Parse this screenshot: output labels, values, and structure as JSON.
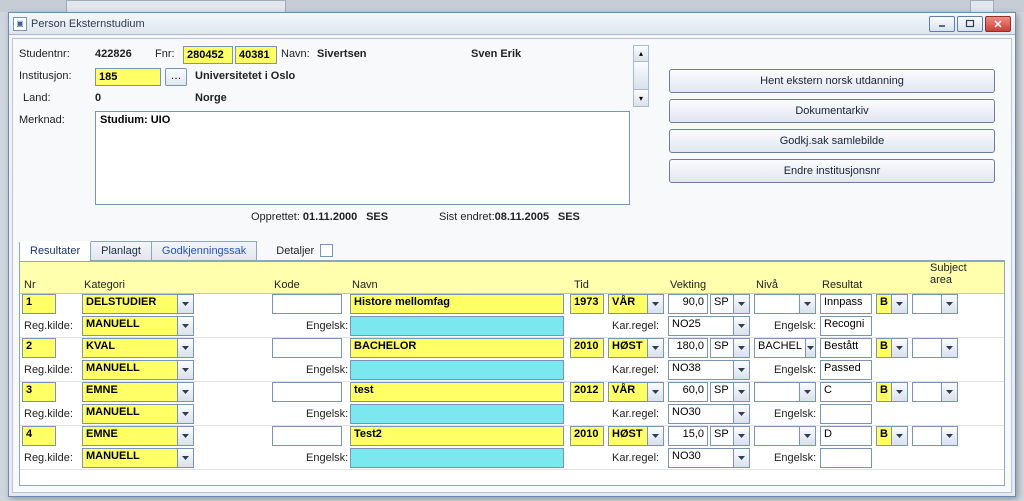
{
  "window": {
    "title": "Person Eksternstudium"
  },
  "header": {
    "studentnr_label": "Studentnr:",
    "studentnr": "422826",
    "fnr_label": "Fnr:",
    "fnr1": "280452",
    "fnr2": "40381",
    "navn_label": "Navn:",
    "etternavn": "Sivertsen",
    "fornavn": "Sven Erik",
    "institusjon_label": "Institusjon:",
    "institusjon_kode": "185",
    "institusjon_navn": "Universitetet i Oslo",
    "land_label": "Land:",
    "land_kode": "0",
    "land_navn": "Norge",
    "merknad_label": "Merknad:",
    "merknad_text": "Studium: UIO",
    "opprettet_label": "Opprettet:",
    "opprettet_dato": "01.11.2000",
    "opprettet_sig": "SES",
    "sistendret_label": "Sist endret:",
    "sistendret_dato": "08.11.2005",
    "sistendret_sig": "SES"
  },
  "actions": {
    "hent": "Hent ekstern norsk utdanning",
    "dokumentarkiv": "Dokumentarkiv",
    "godkjsak": "Godkj.sak samlebilde",
    "endreinst": "Endre institusjonsnr"
  },
  "tabs": {
    "resultater": "Resultater",
    "planlagt": "Planlagt",
    "godkjenningssak": "Godkjenningssak",
    "detaljer": "Detaljer"
  },
  "grid": {
    "headers": {
      "nr": "Nr",
      "kategori": "Kategori",
      "kode": "Kode",
      "navn": "Navn",
      "tid": "Tid",
      "vekting": "Vekting",
      "niva": "Nivå",
      "resultat": "Resultat",
      "subjectarea": "Subject area"
    },
    "row_labels": {
      "regkilde": "Reg.kilde:",
      "engelsk": "Engelsk:",
      "karregel": "Kar.regel:",
      "engelsk2": "Engelsk:"
    },
    "rows": [
      {
        "nr": "1",
        "kategori": "DELSTUDIER",
        "kode": "",
        "navn": "Histore mellomfag",
        "aar": "1973",
        "termin": "VÅR",
        "vekting": "90,0",
        "vektenhet": "SP",
        "niva": "",
        "resultat": "Innpass",
        "subjectarea": "B",
        "regkilde": "MANUELL",
        "engelsk": "",
        "karregel": "NO25",
        "engelsk_res": "Recogni"
      },
      {
        "nr": "2",
        "kategori": "KVAL",
        "kode": "",
        "navn": "BACHELOR",
        "aar": "2010",
        "termin": "HØST",
        "vekting": "180,0",
        "vektenhet": "SP",
        "niva": "BACHEL",
        "resultat": "Bestått",
        "subjectarea": "B",
        "regkilde": "MANUELL",
        "engelsk": "",
        "karregel": "NO38",
        "engelsk_res": "Passed"
      },
      {
        "nr": "3",
        "kategori": "EMNE",
        "kode": "",
        "navn": "test",
        "aar": "2012",
        "termin": "VÅR",
        "vekting": "60,0",
        "vektenhet": "SP",
        "niva": "",
        "resultat": "C",
        "subjectarea": "B",
        "regkilde": "MANUELL",
        "engelsk": "",
        "karregel": "NO30",
        "engelsk_res": ""
      },
      {
        "nr": "4",
        "kategori": "EMNE",
        "kode": "",
        "navn": "Test2",
        "aar": "2010",
        "termin": "HØST",
        "vekting": "15,0",
        "vektenhet": "SP",
        "niva": "",
        "resultat": "D",
        "subjectarea": "B",
        "regkilde": "MANUELL",
        "engelsk": "",
        "karregel": "NO30",
        "engelsk_res": ""
      }
    ]
  }
}
